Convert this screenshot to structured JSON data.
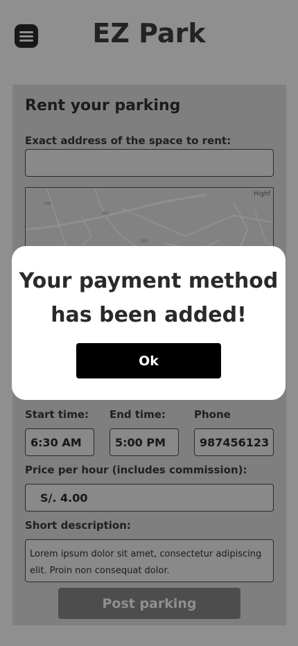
{
  "header": {
    "title": "EZ Park",
    "menu_icon": "hamburger-menu-icon"
  },
  "form": {
    "title": "Rent your parking",
    "address_label": "Exact address of the space to rent:",
    "address_value": "",
    "map_label": "Highf",
    "start_time_label": "Start time:",
    "start_time_value": "6:30 AM",
    "end_time_label": "End time:",
    "end_time_value": "5:00 PM",
    "phone_label": "Phone",
    "phone_value": "987456123",
    "price_label": "Price per hour (includes commission):",
    "price_value": "S/. 4.00",
    "description_label": "Short description:",
    "description_value": "Lorem ipsum dolor sit amet, consectetur adipiscing elit. Proin non consequat dolor.",
    "post_button": "Post parking"
  },
  "modal": {
    "line1": "Your payment method",
    "line2": "has been added!",
    "ok_button": "Ok"
  }
}
